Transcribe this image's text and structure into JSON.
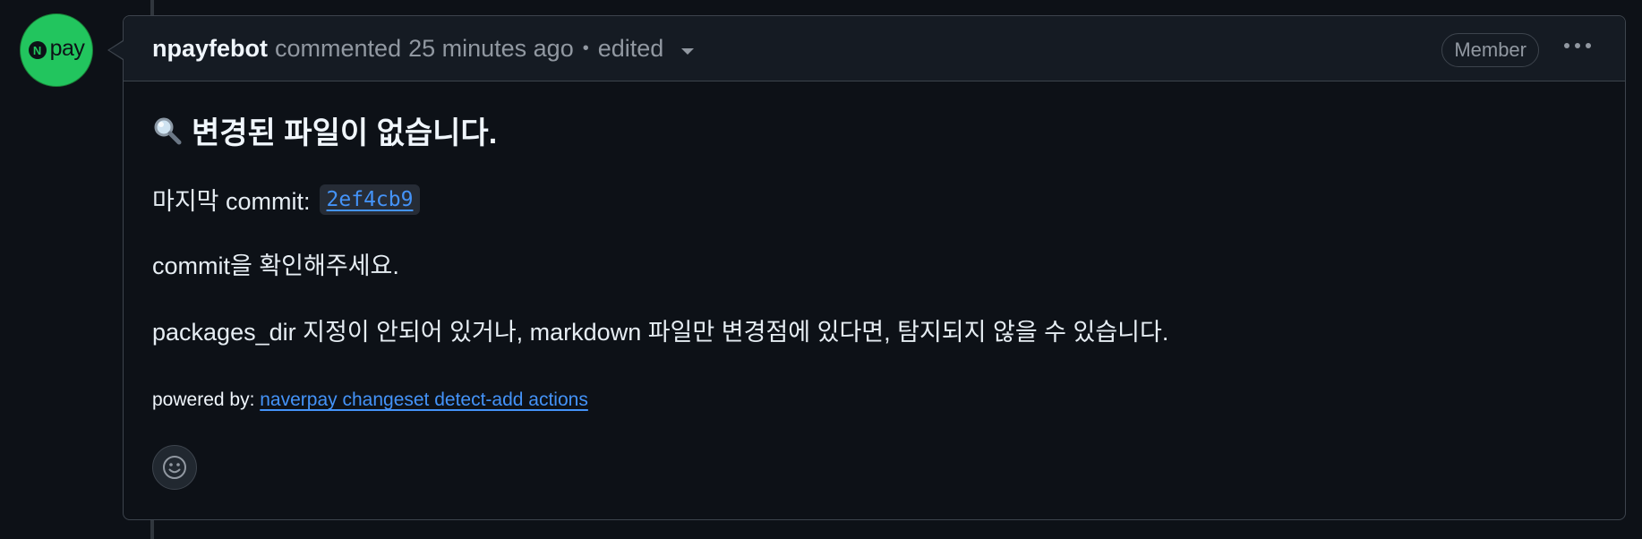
{
  "avatar": {
    "badge_letter": "N",
    "brand_text": "pay"
  },
  "header": {
    "author": "npayfebot",
    "action": "commented",
    "time": "25 minutes ago",
    "separator": "•",
    "edited": "edited",
    "role_badge": "Member"
  },
  "body": {
    "heading_icon": "magnifying-glass-icon",
    "heading": "변경된 파일이 없습니다.",
    "last_commit_label": "마지막 commit:",
    "commit_hash": "2ef4cb9",
    "check_text": "commit을 확인해주세요.",
    "note_text": "packages_dir 지정이 안되어 있거나, markdown 파일만 변경점에 있다면, 탐지되지 않을 수 있습니다.",
    "powered_label": "powered by:",
    "powered_link": "naverpay changeset detect-add actions"
  },
  "colors": {
    "background": "#0d1117",
    "header_bg": "#151b23",
    "border": "#3d444d",
    "link": "#4493f8",
    "avatar_green": "#22c55e"
  }
}
